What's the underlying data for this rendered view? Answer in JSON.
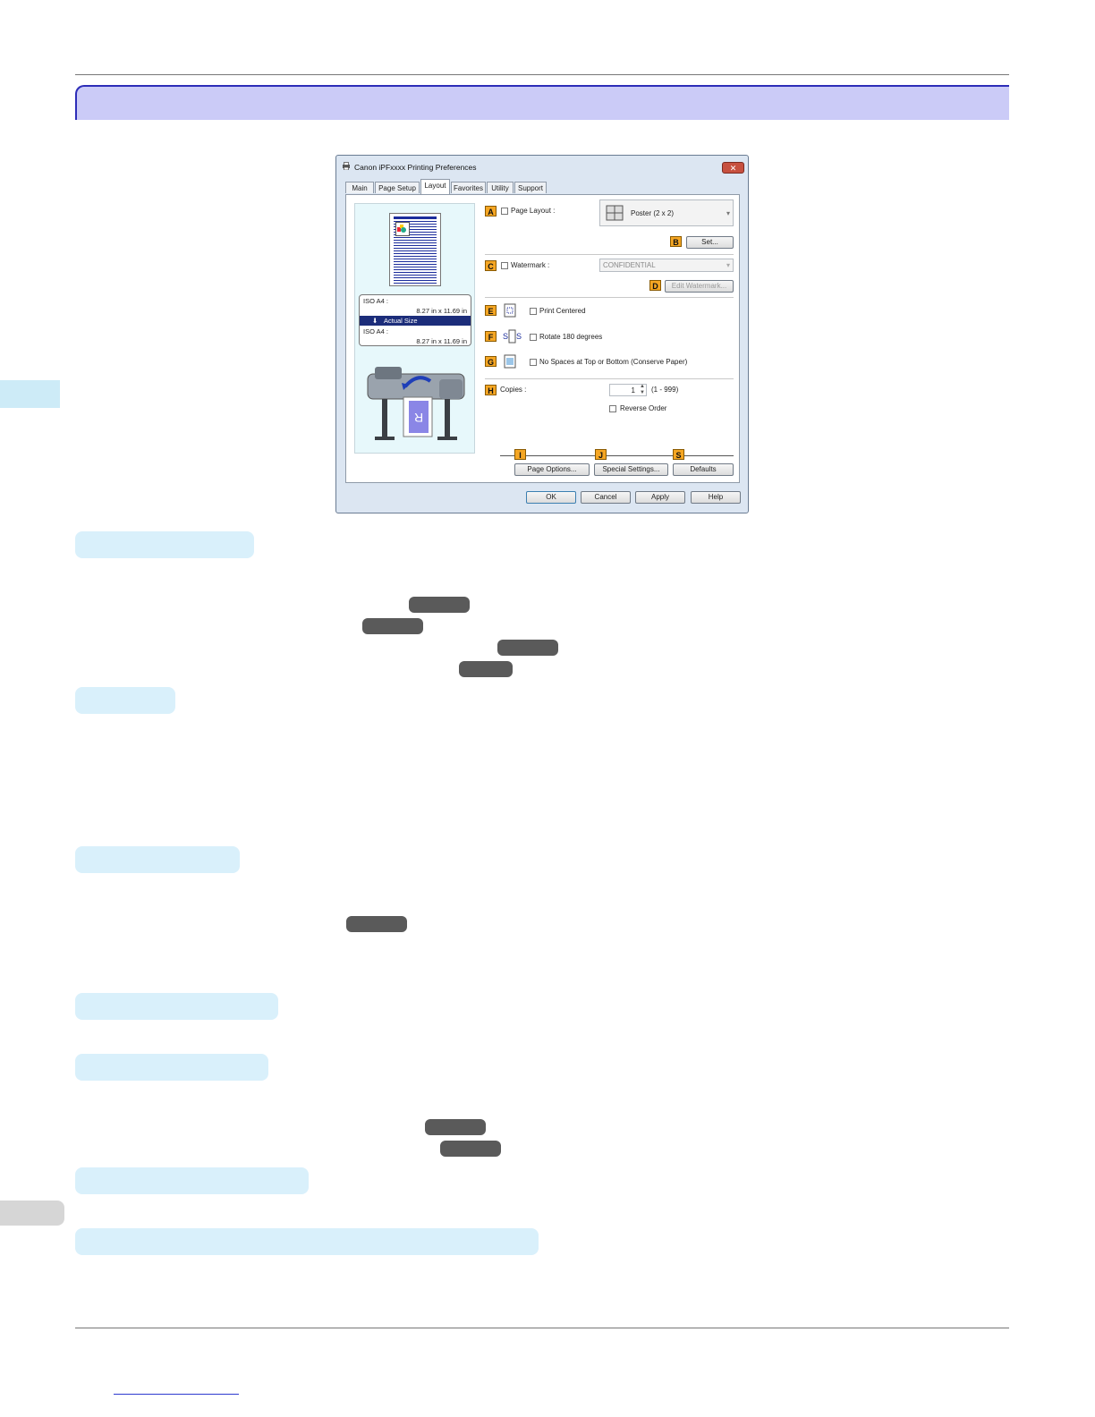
{
  "dialog": {
    "title": "Canon iPFxxxx Printing Preferences",
    "close_label": "✕",
    "tabs": [
      "Main",
      "Page Setup",
      "Layout",
      "Favorites",
      "Utility",
      "Support"
    ],
    "active_tab": "Layout",
    "preview": {
      "source_size_label": "ISO A4 :",
      "source_size_value": "8.27 in x 11.69 in",
      "mode": "Actual Size",
      "output_size_label": "ISO A4 :",
      "output_size_value": "8.27 in x 11.69 in"
    },
    "labels": {
      "A": "A",
      "B": "B",
      "C": "C",
      "D": "D",
      "E": "E",
      "F": "F",
      "G": "G",
      "H": "H",
      "I": "I",
      "J": "J",
      "S": "S"
    },
    "page_layout_label": "Page Layout :",
    "page_layout_value": "Poster (2 x 2)",
    "set_button": "Set...",
    "watermark_label": "Watermark :",
    "watermark_value": "CONFIDENTIAL",
    "edit_watermark_button": "Edit Watermark...",
    "print_centered_label": "Print Centered",
    "rotate_label": "Rotate 180 degrees",
    "no_spaces_label": "No Spaces at Top or Bottom (Conserve Paper)",
    "copies_label": "Copies :",
    "copies_value": "1",
    "copies_range": "(1 - 999)",
    "reverse_order_label": "Reverse Order",
    "page_options_button": "Page Options...",
    "special_settings_button": "Special Settings...",
    "defaults_button": "Defaults",
    "ok_button": "OK",
    "cancel_button": "Cancel",
    "apply_button": "Apply",
    "help_button": "Help"
  }
}
